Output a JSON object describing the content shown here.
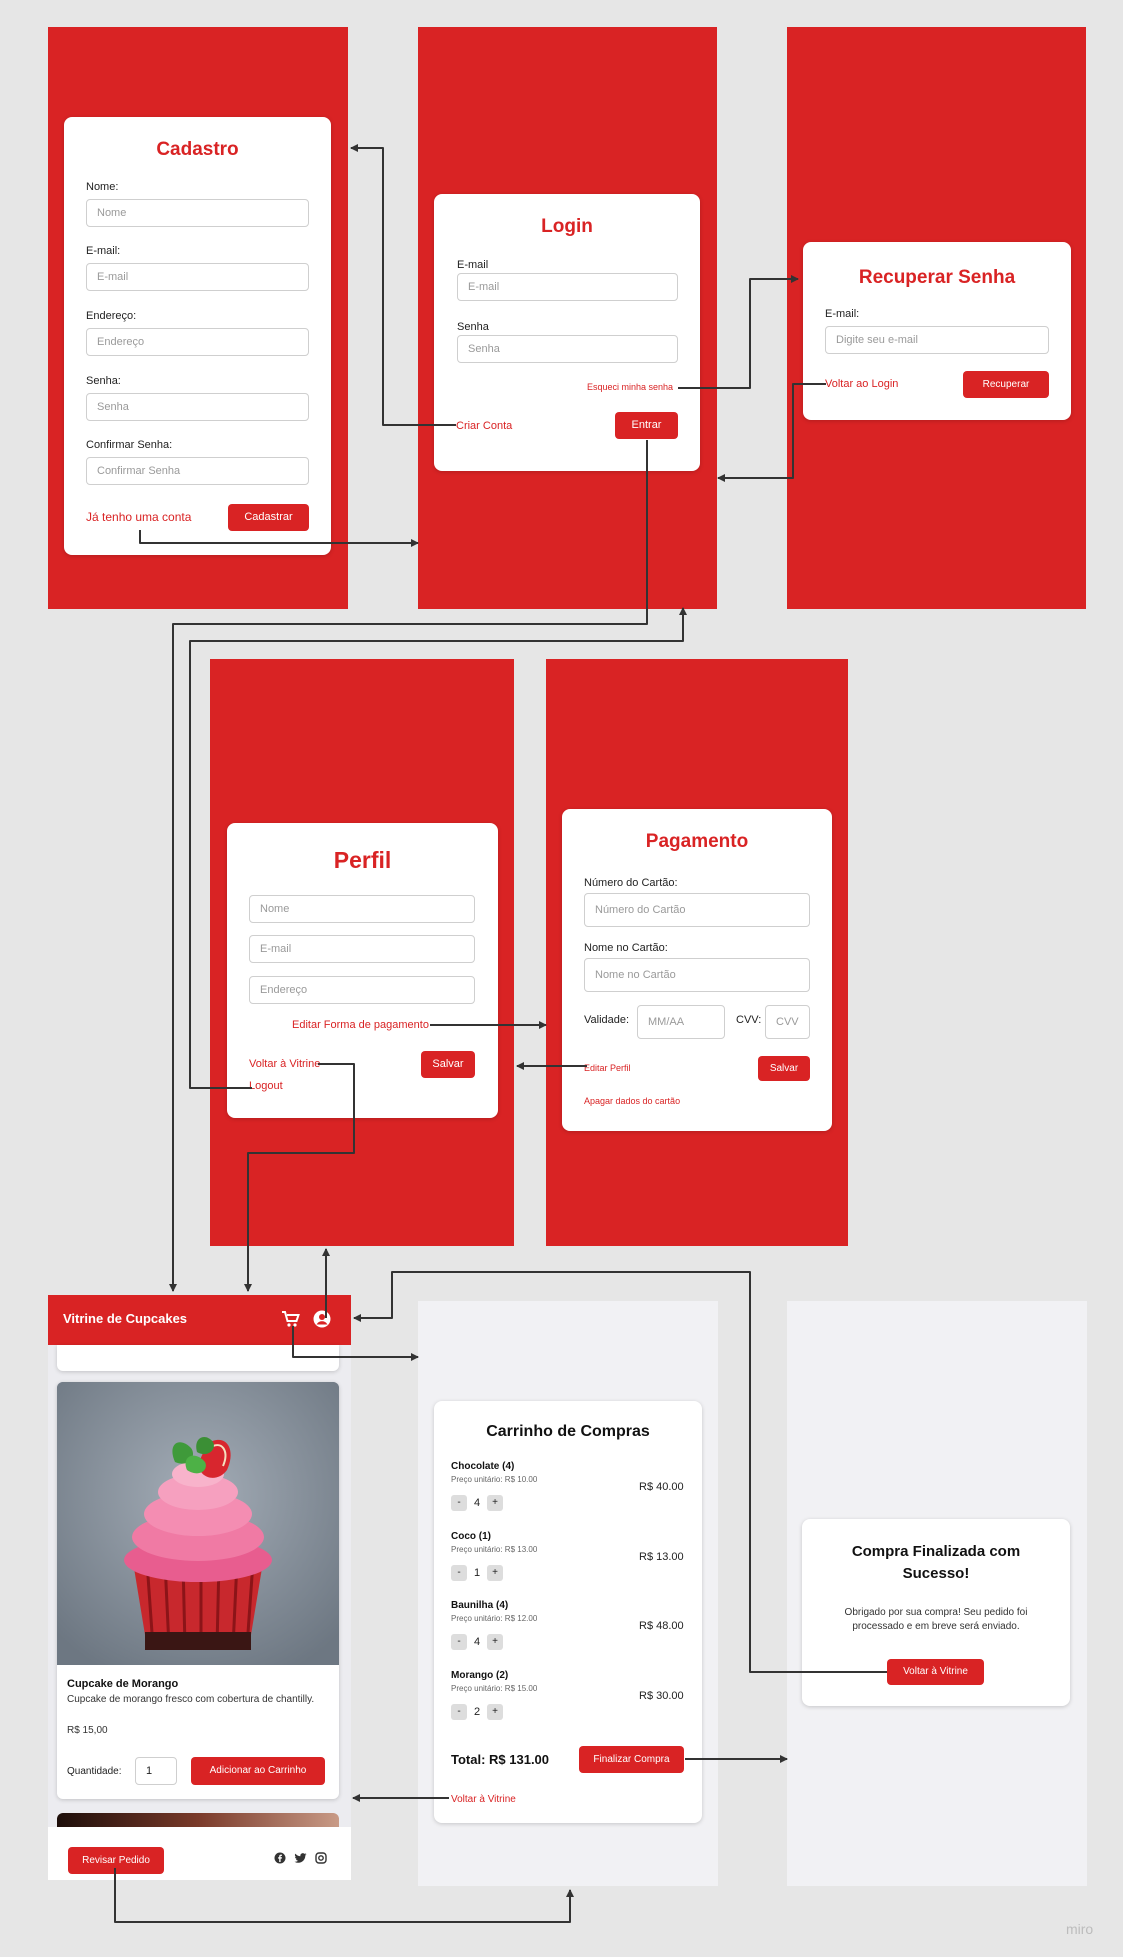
{
  "cadastro": {
    "title": "Cadastro",
    "fields": [
      {
        "label": "Nome:",
        "placeholder": "Nome"
      },
      {
        "label": "E-mail:",
        "placeholder": "E-mail"
      },
      {
        "label": "Endereço:",
        "placeholder": "Endereço"
      },
      {
        "label": "Senha:",
        "placeholder": "Senha"
      },
      {
        "label": "Confirmar Senha:",
        "placeholder": "Confirmar Senha"
      }
    ],
    "have_account_link": "Já tenho uma conta",
    "submit_label": "Cadastrar"
  },
  "login": {
    "title": "Login",
    "fields": [
      {
        "label": "E-mail",
        "placeholder": "E-mail"
      },
      {
        "label": "Senha",
        "placeholder": "Senha"
      }
    ],
    "forgot_link": "Esqueci minha senha",
    "create_link": "Criar Conta",
    "submit_label": "Entrar"
  },
  "recover": {
    "title": "Recuperar Senha",
    "email_label": "E-mail:",
    "email_placeholder": "Digite seu e-mail",
    "back_link": "Voltar ao Login",
    "submit_label": "Recuperar"
  },
  "perfil": {
    "title": "Perfil",
    "placeholders": [
      "Nome",
      "E-mail",
      "Endereço"
    ],
    "edit_payment_link": "Editar Forma de pagamento",
    "back_link": "Voltar à Vitrine",
    "logout_link": "Logout",
    "save_label": "Salvar"
  },
  "pagamento": {
    "title": "Pagamento",
    "card_number_label": "Número do Cartão:",
    "card_number_placeholder": "Número do Cartão",
    "card_name_label": "Nome no Cartão:",
    "card_name_placeholder": "Nome no Cartão",
    "validity_label": "Validade:",
    "validity_placeholder": "MM/AA",
    "cvv_label": "CVV:",
    "cvv_placeholder": "CVV",
    "edit_profile_link": "Editar Perfil",
    "save_label": "Salvar",
    "delete_card_link": "Apagar dados do cartão"
  },
  "vitrine": {
    "header_title": "Vitrine de Cupcakes",
    "product": {
      "name": "Cupcake de Morango",
      "description": "Cupcake de morango fresco com cobertura de chantilly.",
      "price": "R$ 15,00",
      "quantity_label": "Quantidade:",
      "quantity_value": "1",
      "add_label": "Adicionar ao Carrinho"
    },
    "review_label": "Revisar Pedido",
    "accent": "#d92324"
  },
  "carrinho": {
    "title": "Carrinho de Compras",
    "items": [
      {
        "name": "Chocolate (4)",
        "unit": "Preço unitário: R$ 10.00",
        "qty": "4",
        "total": "R$ 40.00"
      },
      {
        "name": "Coco (1)",
        "unit": "Preço unitário: R$ 13.00",
        "qty": "1",
        "total": "R$ 13.00"
      },
      {
        "name": "Baunilha (4)",
        "unit": "Preço unitário: R$ 12.00",
        "qty": "4",
        "total": "R$ 48.00"
      },
      {
        "name": "Morango (2)",
        "unit": "Preço unitário: R$ 15.00",
        "qty": "2",
        "total": "R$ 30.00"
      }
    ],
    "minus": "-",
    "plus": "+",
    "total": "Total: R$ 131.00",
    "finish_label": "Finalizar Compra",
    "back_link": "Voltar à Vitrine"
  },
  "sucesso": {
    "title": "Compra Finalizada com Sucesso!",
    "message": "Obrigado por sua compra! Seu pedido foi processado e em breve será enviado.",
    "back_label": "Voltar à Vitrine"
  },
  "watermark": "miro"
}
